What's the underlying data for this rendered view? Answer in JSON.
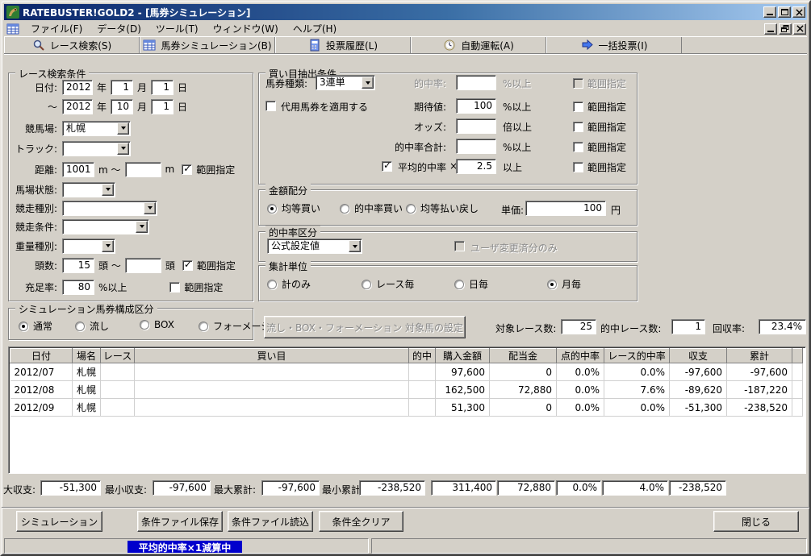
{
  "colors": {
    "titlebar_start": "#0a246a",
    "titlebar_end": "#a6caf0",
    "window_face": "#d4d0c8",
    "status_badge_bg": "#0000cc"
  },
  "titlebar": {
    "title": "RATEBUSTER!GOLD2 - [馬券シミュレーション]"
  },
  "menubar": {
    "items": [
      {
        "label": "ファイル(F)"
      },
      {
        "label": "データ(D)"
      },
      {
        "label": "ツール(T)"
      },
      {
        "label": "ウィンドウ(W)"
      },
      {
        "label": "ヘルプ(H)"
      }
    ]
  },
  "toolbar": {
    "buttons": [
      {
        "label": "レース検索(S)",
        "icon": "search-icon"
      },
      {
        "label": "馬券シミュレーション(B)",
        "icon": "grid-icon"
      },
      {
        "label": "投票履歴(L)",
        "icon": "history-icon"
      },
      {
        "label": "自動運転(A)",
        "icon": "clock-icon"
      },
      {
        "label": "一括投票(I)",
        "icon": "arrow-icon"
      }
    ]
  },
  "race_search": {
    "title": "レース検索条件",
    "labels": {
      "date": "日付:",
      "tilde": "～",
      "year": "年",
      "month": "月",
      "day": "日",
      "course": "競馬場:",
      "track": "トラック:",
      "distance": "距離:",
      "m_tilde": "m ～",
      "m": "m",
      "condition": "馬場状態:",
      "race_type": "競走種別:",
      "race_cond": "競走条件:",
      "weight": "重量種別:",
      "heads": "頭数:",
      "head_tilde": "頭 ～",
      "head": "頭",
      "fill": "充足率:",
      "pct_min": "%以上",
      "range": "範囲指定"
    },
    "values": {
      "from_year": "2012",
      "from_month": "1",
      "from_day": "1",
      "to_year": "2012",
      "to_month": "10",
      "to_day": "1",
      "course": "札幌",
      "track": "",
      "distance_from": "1001",
      "distance_to": "",
      "condition": "",
      "race_type": "",
      "race_cond": "",
      "weight": "",
      "heads_from": "15",
      "heads_to": "",
      "fill": "80"
    },
    "checks": {
      "distance_range": true,
      "heads_range": true,
      "fill_range": false
    }
  },
  "ticket_form": {
    "title": "シミュレーション馬券構成区分",
    "options": [
      {
        "label": "通常",
        "selected": true
      },
      {
        "label": "流し",
        "selected": false
      },
      {
        "label": "BOX",
        "selected": false
      },
      {
        "label": "フォーメーション",
        "selected": false
      }
    ]
  },
  "extract": {
    "title": "買い目抽出条件",
    "ticket_type_label": "馬券種類:",
    "ticket_type_value": "3連単",
    "substitute_label": "代用馬券を適用する",
    "substitute_checked": false,
    "times": "×",
    "rows": [
      {
        "label": "的中率:",
        "value": "",
        "unit": "%以上",
        "range": "範囲指定",
        "disabled": true
      },
      {
        "label": "期待値:",
        "value": "100",
        "unit": "%以上",
        "range": "範囲指定",
        "disabled": false
      },
      {
        "label": "オッズ:",
        "value": "",
        "unit": "倍以上",
        "range": "範囲指定",
        "disabled": false
      },
      {
        "label": "的中率合計:",
        "value": "",
        "unit": "%以上",
        "range": "範囲指定",
        "disabled": false
      },
      {
        "label": "平均的中率",
        "value": "2.5",
        "unit": "以上",
        "range": "範囲指定",
        "disabled": false,
        "checked": true
      }
    ]
  },
  "amount": {
    "title": "金額配分",
    "options": [
      {
        "label": "均等買い",
        "selected": true
      },
      {
        "label": "的中率買い",
        "selected": false
      },
      {
        "label": "均等払い戻し",
        "selected": false
      }
    ],
    "unit_price_label": "単価:",
    "unit_price_value": "100",
    "unit_price_unit": "円"
  },
  "hit_class": {
    "title": "的中率区分",
    "value": "公式設定値",
    "user_only_label": "ユーザ変更済分のみ",
    "user_only_checked": false
  },
  "aggregate": {
    "title": "集計単位",
    "options": [
      {
        "label": "計のみ",
        "selected": false
      },
      {
        "label": "レース毎",
        "selected": false
      },
      {
        "label": "日毎",
        "selected": false
      },
      {
        "label": "月毎",
        "selected": true
      }
    ]
  },
  "sim_bar": {
    "target_button": "流し・BOX・フォーメーション 対象馬の設定",
    "target_races_label": "対象レース数:",
    "target_races": "25",
    "hit_races_label": "的中レース数:",
    "hit_races": "1",
    "recovery_label": "回収率:",
    "recovery": "23.4%"
  },
  "table": {
    "columns": [
      "日付",
      "場名",
      "レース",
      "買い目",
      "的中",
      "購入金額",
      "配当金",
      "点的中率",
      "レース的中率",
      "収支",
      "累計"
    ],
    "rows": [
      [
        "2012/07",
        "札幌",
        "",
        "",
        "",
        "97,600",
        "0",
        "0.0%",
        "0.0%",
        "-97,600",
        "-97,600"
      ],
      [
        "2012/08",
        "札幌",
        "",
        "",
        "",
        "162,500",
        "72,880",
        "0.0%",
        "7.6%",
        "-89,620",
        "-187,220"
      ],
      [
        "2012/09",
        "札幌",
        "",
        "",
        "",
        "51,300",
        "0",
        "0.0%",
        "0.0%",
        "-51,300",
        "-238,520"
      ]
    ]
  },
  "summary": {
    "max_balance_label": "大収支:",
    "max_balance": "-51,300",
    "min_balance_label": "最小収支:",
    "min_balance": "-97,600",
    "max_total_label": "最大累計:",
    "max_total": "-97,600",
    "min_total_label": "最小累計:",
    "min_total": "-238,520",
    "totals": [
      "311,400",
      "72,880",
      "0.0%",
      "4.0%",
      "-238,520"
    ]
  },
  "actions": {
    "simulate": "シミュレーション",
    "save": "条件ファイル保存",
    "load": "条件ファイル読込",
    "clear": "条件全クリア",
    "close": "閉じる"
  },
  "statusbar": {
    "message": "平均的中率×1減算中"
  }
}
